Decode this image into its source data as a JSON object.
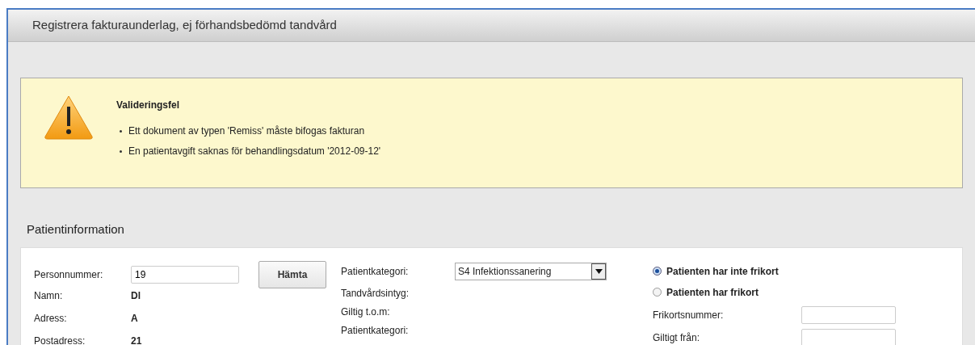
{
  "window": {
    "title": "Registrera fakturaunderlag, ej förhandsbedömd tandvård"
  },
  "validation": {
    "title": "Valideringsfel",
    "errors": [
      "Ett dokument av typen 'Remiss' måste bifogas fakturan",
      "En patientavgift saknas för behandlingsdatum '2012-09-12'"
    ]
  },
  "patient_section": {
    "heading": "Patientinformation",
    "personnummer": {
      "label": "Personnummer:",
      "value": "19"
    },
    "fetch_button": "Hämta",
    "details": [
      {
        "label": "Namn:",
        "value": "Dl"
      },
      {
        "label": "Adress:",
        "value": "A"
      },
      {
        "label": "Postadress:",
        "value": "21"
      }
    ],
    "category": {
      "label": "Patientkategori:",
      "value": "S4 Infektionssanering"
    },
    "middle_labels": [
      "Tandvårdsintyg:",
      "Giltig t.o.m:",
      "Patientkategori:"
    ],
    "frikort_options": [
      {
        "label": "Patienten har inte frikort",
        "selected": true
      },
      {
        "label": "Patienten har frikort",
        "selected": false
      }
    ],
    "frikort_fields": [
      {
        "label": "Frikortsnummer:"
      },
      {
        "label": "Giltigt från:"
      }
    ]
  }
}
